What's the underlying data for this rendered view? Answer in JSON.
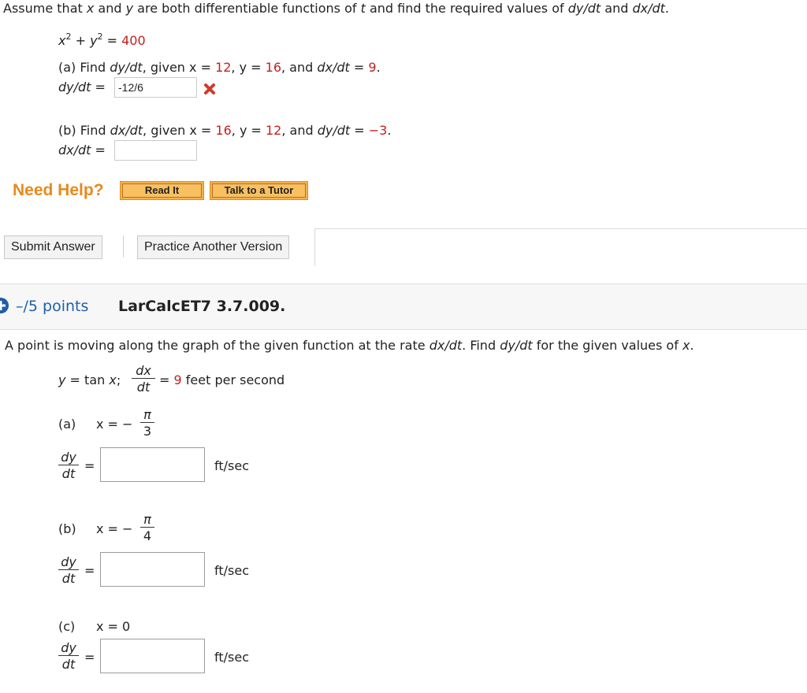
{
  "q1": {
    "instructions_parts": [
      "Assume that ",
      "x",
      " and ",
      "y",
      " are both differentiable functions of ",
      "t",
      " and find the required values of ",
      "dy/dt",
      " and ",
      "dx/dt",
      "."
    ],
    "equation": {
      "lhs_x": "x",
      "lhs_y": "y",
      "exp": "2",
      "plus": "+",
      "equals": "=",
      "rhs": "400"
    },
    "part_a": {
      "text": "(a) Find ",
      "target": "dy/dt",
      "given": ", given ",
      "x_label": "x = ",
      "x_val": "12",
      "y_label": "y = ",
      "y_val": "16",
      "rate_label": "dx/dt",
      "rate_eq": " = ",
      "rate_val": "9",
      "end": ".",
      "answer_label": "dy/dt",
      "answer_eq": " = ",
      "answer_value": "-12/6",
      "status": "incorrect"
    },
    "part_b": {
      "text": "(b) Find ",
      "target": "dx/dt",
      "given": ", given ",
      "x_label": "x = ",
      "x_val": "16",
      "y_label": "y = ",
      "y_val": "12",
      "rate_label": "dy/dt",
      "rate_eq": " = ",
      "rate_val": "−3",
      "end": ".",
      "answer_label": "dx/dt",
      "answer_eq": " = ",
      "answer_value": ""
    },
    "help": {
      "label": "Need Help?",
      "read_it": "Read It",
      "talk_tutor": "Talk to a Tutor"
    },
    "actions": {
      "submit": "Submit Answer",
      "practice": "Practice Another Version"
    }
  },
  "q2": {
    "points": "–/5 points",
    "code": "LarCalcET7 3.7.009.",
    "prompt_parts": [
      "A point is moving along the graph of the given function at the rate ",
      "dx/dt",
      ". Find ",
      "dy/dt",
      " for the given values of ",
      "x",
      "."
    ],
    "function": {
      "y": "y",
      "eq": " = tan ",
      "x": "x",
      "semi": ";",
      "num": "dx",
      "den": "dt",
      "eq2": "=",
      "rate": "9",
      "unit_text": "feet per second"
    },
    "parts": [
      {
        "label": "(a)",
        "x_expr": "x = −",
        "num": "π",
        "den": "3",
        "unit": "ft/sec"
      },
      {
        "label": "(b)",
        "x_expr": "x = −",
        "num": "π",
        "den": "4",
        "unit": "ft/sec"
      },
      {
        "label": "(c)",
        "x_expr": "x = 0",
        "unit": "ft/sec"
      }
    ],
    "deriv": {
      "num": "dy",
      "den": "dt",
      "eq": "="
    }
  },
  "colors": {
    "accent_red": "#c4201c",
    "help_orange": "#e8891c",
    "points_blue": "#1f5fa8"
  }
}
